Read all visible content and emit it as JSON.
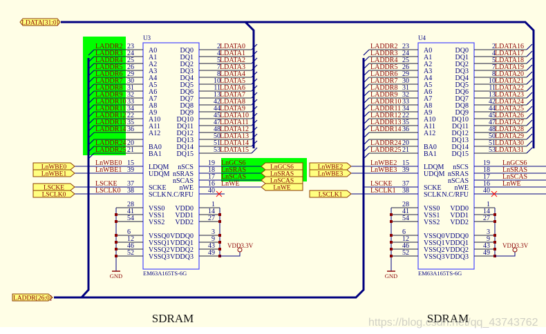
{
  "colors": {
    "background": "#fffee6",
    "bus": "#00007f",
    "wire": "#000080",
    "pin": "#1a1a3a",
    "net_label": "#8b0000",
    "pin_name": "#000080",
    "chip_border": "#4646ff",
    "port_fill": "#ffff80",
    "port_border": "#8b3a00",
    "highlight": "#00ff00",
    "no_connect": "#ff0000"
  },
  "buses": {
    "data_port": "LDATA[31:0]",
    "addr_port": "LADDR[26:0]"
  },
  "pins": {
    "addr": [
      {
        "name": "A0",
        "num": "23"
      },
      {
        "name": "A1",
        "num": "24"
      },
      {
        "name": "A2",
        "num": "25"
      },
      {
        "name": "A3",
        "num": "26"
      },
      {
        "name": "A4",
        "num": "29"
      },
      {
        "name": "A5",
        "num": "30"
      },
      {
        "name": "A6",
        "num": "31"
      },
      {
        "name": "A7",
        "num": "32"
      },
      {
        "name": "A8",
        "num": "33"
      },
      {
        "name": "A9",
        "num": "34"
      },
      {
        "name": "A10",
        "num": "22"
      },
      {
        "name": "A11",
        "num": "35"
      },
      {
        "name": "A12",
        "num": "36"
      },
      {
        "name": "",
        "num": ""
      },
      {
        "name": "BA0",
        "num": "20"
      },
      {
        "name": "BA1",
        "num": "21"
      }
    ],
    "data": [
      {
        "name": "DQ0",
        "num": "2"
      },
      {
        "name": "DQ1",
        "num": "4"
      },
      {
        "name": "DQ2",
        "num": "5"
      },
      {
        "name": "DQ3",
        "num": "7"
      },
      {
        "name": "DQ4",
        "num": "8"
      },
      {
        "name": "DQ5",
        "num": "10"
      },
      {
        "name": "DQ6",
        "num": "11"
      },
      {
        "name": "DQ7",
        "num": "13"
      },
      {
        "name": "DQ8",
        "num": "42"
      },
      {
        "name": "DQ9",
        "num": "44"
      },
      {
        "name": "DQ10",
        "num": "45"
      },
      {
        "name": "DQ11",
        "num": "47"
      },
      {
        "name": "DQ12",
        "num": "48"
      },
      {
        "name": "DQ13",
        "num": "50"
      },
      {
        "name": "DQ14",
        "num": "51"
      },
      {
        "name": "DQ15",
        "num": "53"
      }
    ],
    "ctrl_left": [
      {
        "name": "LDQM",
        "num": "15",
        "row": 0
      },
      {
        "name": "UDQM",
        "num": "39",
        "row": 1
      },
      {
        "name": "SCKE",
        "num": "37",
        "row": 3
      },
      {
        "name": "SCLK",
        "num": "38",
        "row": 4
      }
    ],
    "ctrl_right": [
      {
        "name": "nSCS",
        "num": "19",
        "row": 0
      },
      {
        "name": "nSRAS",
        "num": "18",
        "row": 1
      },
      {
        "name": "nSCAS",
        "num": "17",
        "row": 2
      },
      {
        "name": "nWE",
        "num": "16",
        "row": 3
      },
      {
        "name": "N.C/RFU",
        "num": "40",
        "row": 4
      }
    ],
    "power_left": [
      {
        "name": "VSS0",
        "num": "28",
        "row": 0
      },
      {
        "name": "VSS1",
        "num": "41",
        "row": 1
      },
      {
        "name": "VSS2",
        "num": "54",
        "row": 2
      },
      {
        "name": "VSSQ0",
        "num": "6",
        "row": 4
      },
      {
        "name": "VSSQ1",
        "num": "12",
        "row": 5
      },
      {
        "name": "VSSQ2",
        "num": "46",
        "row": 6
      },
      {
        "name": "VSSQ3",
        "num": "52",
        "row": 7
      }
    ],
    "power_right": [
      {
        "name": "VDD0",
        "num": "1",
        "row": 0
      },
      {
        "name": "VDD1",
        "num": "14",
        "row": 1
      },
      {
        "name": "VDD2",
        "num": "27",
        "row": 2
      },
      {
        "name": "VDDQ0",
        "num": "3",
        "row": 4
      },
      {
        "name": "VDDQ1",
        "num": "9",
        "row": 5
      },
      {
        "name": "VDDQ2",
        "num": "43",
        "row": 6
      },
      {
        "name": "VDDQ3",
        "num": "49",
        "row": 7
      }
    ]
  },
  "chips": [
    {
      "ref": "U3",
      "part": "EM63A165TS-6G",
      "title": "SDRAM",
      "gnd": "GND",
      "vdd": "VDD3.3V",
      "addr_nets": [
        "LADDR2",
        "LADDR3",
        "LADDR4",
        "LADDR5",
        "LADDR6",
        "LADDR7",
        "LADDR8",
        "LADDR9",
        "LADDR10",
        "LADDR11",
        "LADDR12",
        "LADDR13",
        "LADDR14",
        "",
        "LADDR24",
        "LADDR25"
      ],
      "data_nets": [
        "LDATA0",
        "LDATA1",
        "LDATA2",
        "LDATA3",
        "LDATA4",
        "LDATA5",
        "LDATA6",
        "LDATA7",
        "LDATA8",
        "LDATA9",
        "LDATA10",
        "LDATA11",
        "LDATA12",
        "LDATA13",
        "LDATA14",
        "LDATA15"
      ],
      "ctrl_left_nets": [
        "LnWBE0",
        "LnWBE1",
        "LSCKE",
        "LSCLK0"
      ],
      "ctrl_right_nets": [
        "LnGCS6",
        "LnSRAS",
        "LnSCAS",
        "LnWE",
        ""
      ],
      "left_ports": [
        "LnWBE0",
        "LnWBE1",
        "LSCKE",
        "LSCLK0"
      ],
      "right_ports": [
        "LnGCS6",
        "LnSRAS",
        "LnSCAS",
        "LnWE"
      ]
    },
    {
      "ref": "U4",
      "part": "EM63A165TS-6G",
      "title": "SDRAM",
      "gnd": "GND",
      "vdd": "VDD3.3V",
      "addr_nets": [
        "LADDR2",
        "LADDR3",
        "LADDR4",
        "LADDR5",
        "LADDR6",
        "LADDR7",
        "LADDR8",
        "LADDR9",
        "LADDR10",
        "LADDR11",
        "LADDR12",
        "LADDR13",
        "LADDR14",
        "",
        "LADDR24",
        "LADDR25"
      ],
      "data_nets": [
        "LDATA16",
        "LDATA17",
        "LDATA18",
        "LDATA19",
        "LDATA20",
        "LDATA21",
        "LDATA22",
        "LDATA23",
        "LDATA24",
        "LDATA25",
        "LDATA26",
        "LDATA27",
        "LDATA28",
        "LDATA29",
        "LDATA30",
        "LDATA31"
      ],
      "ctrl_left_nets": [
        "LnWBE2",
        "LnWBE3",
        "LSCKE",
        "LSCLK1"
      ],
      "ctrl_right_nets": [
        "LnGCS6",
        "LnSRAS",
        "LnSCAS",
        "LnWE",
        ""
      ],
      "left_ports": [
        "LnWBE2",
        "LnWBE3",
        "",
        "LSCLK1"
      ],
      "right_ports": []
    }
  ],
  "watermark": "https://blog.csdn.net/qq_43743762"
}
